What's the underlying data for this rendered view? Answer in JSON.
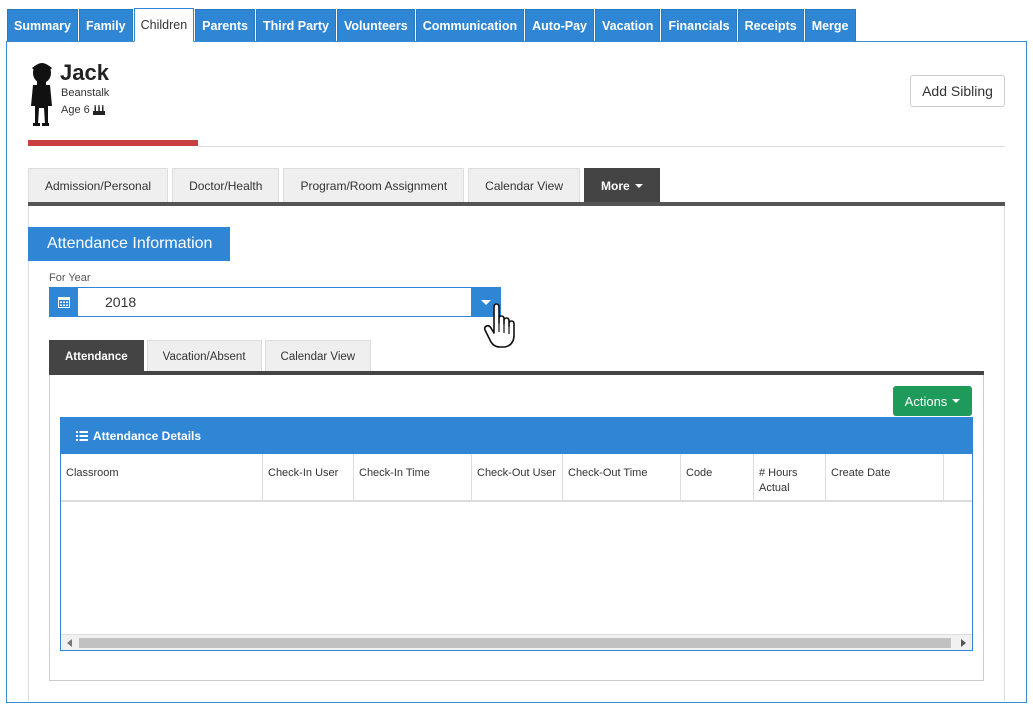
{
  "top_tabs": [
    "Summary",
    "Family",
    "Children",
    "Parents",
    "Third Party",
    "Volunteers",
    "Communication",
    "Auto-Pay",
    "Vacation",
    "Financials",
    "Receipts",
    "Merge"
  ],
  "active_top_tab": "Children",
  "child": {
    "first_name": "Jack",
    "last_name": "Beanstalk",
    "age": "Age 6"
  },
  "add_sibling_label": "Add Sibling",
  "sub_tabs": [
    "Admission/Personal",
    "Doctor/Health",
    "Program/Room Assignment",
    "Calendar View"
  ],
  "more_label": "More",
  "section_title": "Attendance Information",
  "year_filter": {
    "label": "For Year",
    "value": "2018"
  },
  "inner_tabs": [
    "Attendance",
    "Vacation/Absent",
    "Calendar View"
  ],
  "active_inner_tab": "Attendance",
  "actions_label": "Actions",
  "table": {
    "title": "Attendance Details",
    "columns": [
      "Classroom",
      "Check-In User",
      "Check-In Time",
      "Check-Out User",
      "Check-Out Time",
      "Code",
      "# Hours Actual",
      "Create Date"
    ],
    "rows": []
  },
  "colors": {
    "primary_blue": "#2f86d4",
    "actions_green": "#1e9a5b",
    "accent_red": "#c94040",
    "dark_tab": "#444444"
  }
}
